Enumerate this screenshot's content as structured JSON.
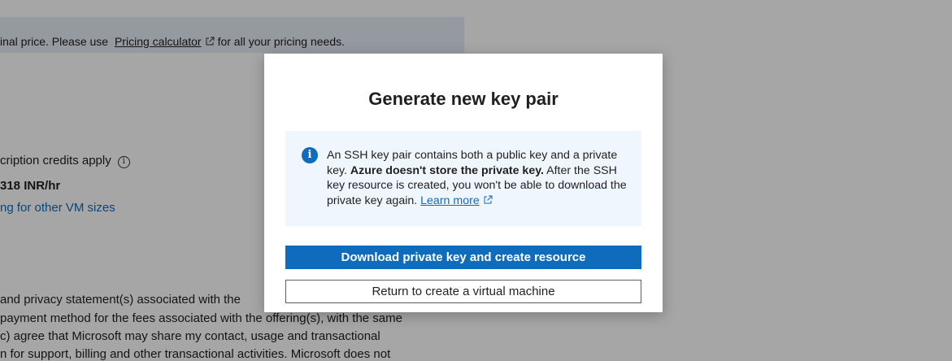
{
  "background": {
    "banner": {
      "prefix": "inal price. Please use",
      "link": "Pricing calculator",
      "suffix": "for all your pricing needs."
    },
    "credits_text": "cription credits apply",
    "price_text": "318 INR/hr",
    "sizes_link": "ng for other VM sizes",
    "terms_lines": [
      " and privacy statement(s) associated with the",
      "payment method for the fees associated with the offering(s), with the same",
      "c) agree that Microsoft may share my contact, usage and transactional",
      "n for support, billing and other transactional activities. Microsoft does not"
    ]
  },
  "dialog": {
    "title": "Generate new key pair",
    "info": {
      "text_before": "An SSH key pair contains both a public key and a private key. ",
      "text_bold": "Azure doesn't store the private key.",
      "text_after": " After the SSH key resource is created, you won't be able to download the private key again. ",
      "learn_more": "Learn more"
    },
    "primary_button": "Download private key and create resource",
    "secondary_button": "Return to create a virtual machine"
  },
  "colors": {
    "accent": "#0f6cbd",
    "info_bg": "#f0f6fe"
  }
}
